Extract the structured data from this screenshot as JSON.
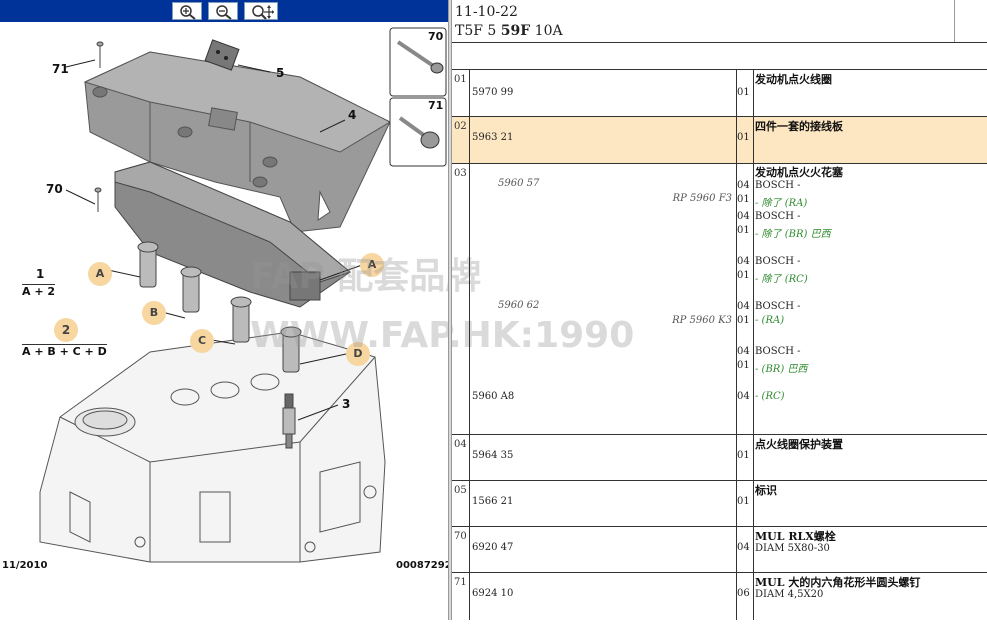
{
  "toolbar": {
    "zoom_in_icon": "zoom-in-icon",
    "zoom_out_icon": "zoom-out-icon",
    "zoom_fit_icon": "zoom-fit-icon",
    "bar_color": "#003399"
  },
  "diagram": {
    "callouts": {
      "n71": "71",
      "n5": "5",
      "n4": "4",
      "n70": "70",
      "n3": "3",
      "group1": "1",
      "group1_formula": "A + 2",
      "group2": "2",
      "group2_formula": "A + B + C + D",
      "A1": "A",
      "A2": "A",
      "B": "B",
      "C": "C",
      "D": "D"
    },
    "inset": {
      "top_label": "70",
      "bottom_label": "71"
    },
    "footer_left": "11/2010",
    "footer_right": "00087292",
    "watermark_line1": "FAP 配套品牌",
    "watermark_line2": "WWW.FAP.HK:1990"
  },
  "header": {
    "date": "11-10-22",
    "code_prefix": "T5F 5",
    "code_bold": "59F",
    "code_suffix": "10A"
  },
  "rows": [
    {
      "idx": "01",
      "ref": "5970 99",
      "qty": "01",
      "title": "发动机点火线圈"
    },
    {
      "idx": "02",
      "ref": "5963 21",
      "qty": "01",
      "title": "四件一套的接线板"
    },
    {
      "idx": "03",
      "title": "发动机点火火花塞",
      "ref1": "5960 57",
      "ref1_alt": "RP 5960 F3",
      "ref2": "5960 62",
      "ref2_alt": "RP 5960 K3",
      "ref3": "5960 A8",
      "lines": [
        {
          "qty": "04",
          "text": "BOSCH -",
          "green": false
        },
        {
          "qty": "01",
          "text": "- 除了 (RA)",
          "green": true
        },
        {
          "qty": "04",
          "text": "BOSCH -",
          "green": false
        },
        {
          "qty": "01",
          "text": "- 除了 (BR) 巴西",
          "green": true
        },
        {
          "qty": "04",
          "text": "BOSCH -",
          "green": false
        },
        {
          "qty": "01",
          "text": "- 除了 (RC)",
          "green": true
        },
        {
          "qty": "04",
          "text": "BOSCH -",
          "green": false
        },
        {
          "qty": "01",
          "text": "- (RA)",
          "green": true
        },
        {
          "qty": "04",
          "text": "BOSCH -",
          "green": false
        },
        {
          "qty": "01",
          "text": "- (BR) 巴西",
          "green": true
        },
        {
          "qty": "04",
          "text": "- (RC)",
          "green": true
        }
      ]
    },
    {
      "idx": "04",
      "ref": "5964 35",
      "qty": "01",
      "title": "点火线圈保护装置"
    },
    {
      "idx": "05",
      "ref": "1566 21",
      "qty": "01",
      "title": "标识"
    },
    {
      "idx": "70",
      "ref": "6920 47",
      "qty": "04",
      "title": "MUL RLX螺栓",
      "sub": "DIAM 5X80-30"
    },
    {
      "idx": "71",
      "ref": "6924 10",
      "qty": "06",
      "title": "MUL 大的内六角花形半圆头螺钉",
      "sub": "DIAM 4,5X20"
    }
  ]
}
